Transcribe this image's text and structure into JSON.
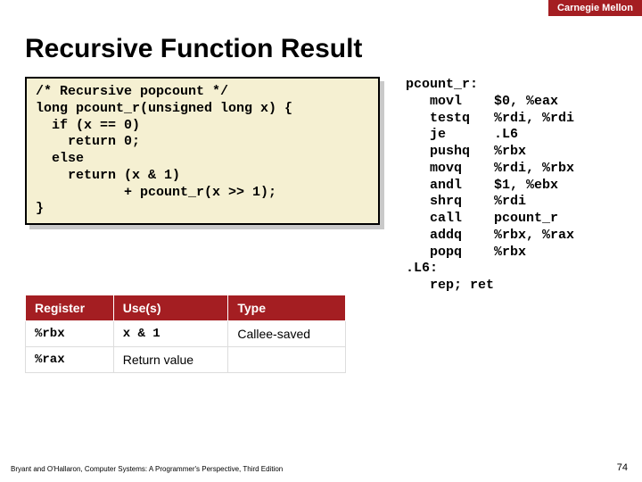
{
  "banner": "Carnegie Mellon",
  "title": "Recursive Function Result",
  "code": "/* Recursive popcount */\nlong pcount_r(unsigned long x) {\n  if (x == 0)\n    return 0;\n  else\n    return (x & 1)\n           + pcount_r(x >> 1);\n}",
  "asm": "pcount_r:\n   movl    $0, %eax\n   testq   %rdi, %rdi\n   je      .L6\n   pushq   %rbx\n   movq    %rdi, %rbx\n   andl    $1, %ebx\n   shrq    %rdi\n   call    pcount_r\n   addq    %rbx, %rax\n   popq    %rbx\n.L6:\n   rep; ret",
  "table": {
    "headers": {
      "c0": "Register",
      "c1": "Use(s)",
      "c2": "Type"
    },
    "rows": [
      {
        "reg": "%rbx",
        "use": "x & 1",
        "type": "Callee-saved"
      },
      {
        "reg": "%rax",
        "use": "Return value",
        "type": ""
      }
    ]
  },
  "footer": {
    "left": "Bryant and O'Hallaron, Computer Systems: A Programmer's Perspective, Third Edition",
    "right": "74"
  }
}
